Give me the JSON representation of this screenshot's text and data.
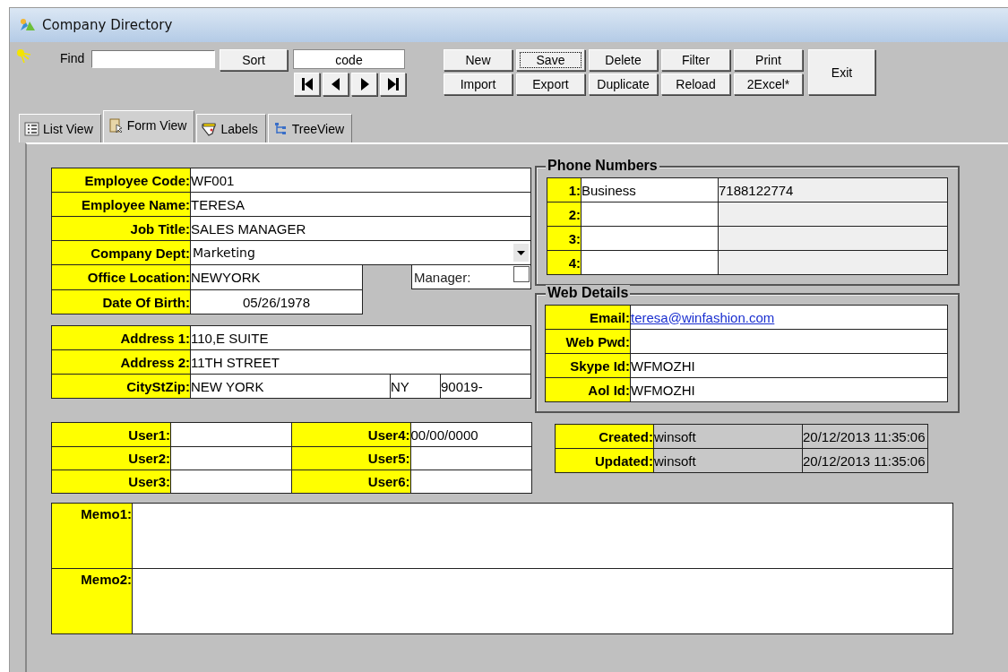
{
  "window": {
    "title": "Company Directory"
  },
  "toolbar": {
    "find": {
      "label": "Find"
    },
    "sort_button": "Sort",
    "sort_field": "code",
    "nav_buttons": [
      {
        "kind": "first"
      },
      {
        "kind": "prev"
      },
      {
        "kind": "next"
      },
      {
        "kind": "last"
      }
    ],
    "buttons": [
      [
        {
          "label": "New",
          "focused": false
        },
        {
          "label": "Save",
          "focused": true
        },
        {
          "label": "Delete",
          "focused": false
        },
        {
          "label": "Filter",
          "focused": false
        },
        {
          "label": "Print",
          "focused": false
        }
      ],
      [
        {
          "label": "Import",
          "focused": false
        },
        {
          "label": "Export",
          "focused": false
        },
        {
          "label": "Duplicate",
          "focused": false
        },
        {
          "label": "Reload",
          "focused": false
        },
        {
          "label": "2Excel*",
          "focused": false
        }
      ]
    ],
    "exit_button": "Exit"
  },
  "tabs": [
    {
      "label": "List View",
      "kind": "list",
      "selected": false
    },
    {
      "label": "Form View",
      "kind": "form",
      "selected": true
    },
    {
      "label": "Labels",
      "kind": "labels",
      "selected": false
    },
    {
      "label": "TreeView",
      "kind": "tree",
      "selected": false
    }
  ],
  "employee": [
    {
      "label": "Employee Code:",
      "value": "WF001",
      "kind": "text"
    },
    {
      "label": "Employee Name:",
      "value": "TERESA",
      "kind": "text"
    },
    {
      "label": "Job Title:",
      "value": "SALES MANAGER",
      "kind": "text"
    },
    {
      "label": "Company Dept:",
      "value": "Marketing",
      "kind": "dropdown"
    }
  ],
  "office": [
    {
      "label": "Office Location:",
      "value": "NEWYORK",
      "kind": "text"
    },
    {
      "label": "Date Of Birth:",
      "value": "05/26/1978",
      "kind": "date"
    }
  ],
  "manager": {
    "label": "Manager:",
    "checked": false
  },
  "address": [
    {
      "label": "Address 1:",
      "value": "110,E SUITE"
    },
    {
      "label": "Address 2:",
      "value": "11TH STREET"
    }
  ],
  "city_st_zip": {
    "label": "CityStZip:",
    "city": "NEW YORK",
    "state": "NY",
    "zip": "90019-"
  },
  "phone_numbers": {
    "title": "Phone Numbers",
    "rows": [
      {
        "label": "1:",
        "type": "Business",
        "number": "7188122774"
      },
      {
        "label": "2:"
      },
      {
        "label": "3:"
      },
      {
        "label": "4:"
      }
    ]
  },
  "web_details": {
    "title": "Web Details",
    "rows": [
      {
        "label": "Email:",
        "value": "teresa@winfashion.com",
        "kind": "link"
      },
      {
        "label": "Web Pwd:",
        "kind": "text"
      },
      {
        "label": "Skype Id:",
        "value": "WFMOZHI",
        "kind": "text"
      },
      {
        "label": "Aol Id:",
        "value": "WFMOZHI",
        "kind": "text"
      }
    ]
  },
  "user_fields": [
    {
      "label": "User1:"
    },
    {
      "label": "User2:"
    },
    {
      "label": "User3:"
    },
    {
      "label": "User4:",
      "value": "00/00/0000"
    },
    {
      "label": "User5:"
    },
    {
      "label": "User6:"
    }
  ],
  "audit": [
    {
      "label": "Created:",
      "user": "winsoft",
      "time": "20/12/2013 11:35:06"
    },
    {
      "label": "Updated:",
      "user": "winsoft",
      "time": "20/12/2013 11:35:06"
    }
  ],
  "memos": [
    {
      "label": "Memo1:"
    },
    {
      "label": "Memo2:"
    }
  ]
}
